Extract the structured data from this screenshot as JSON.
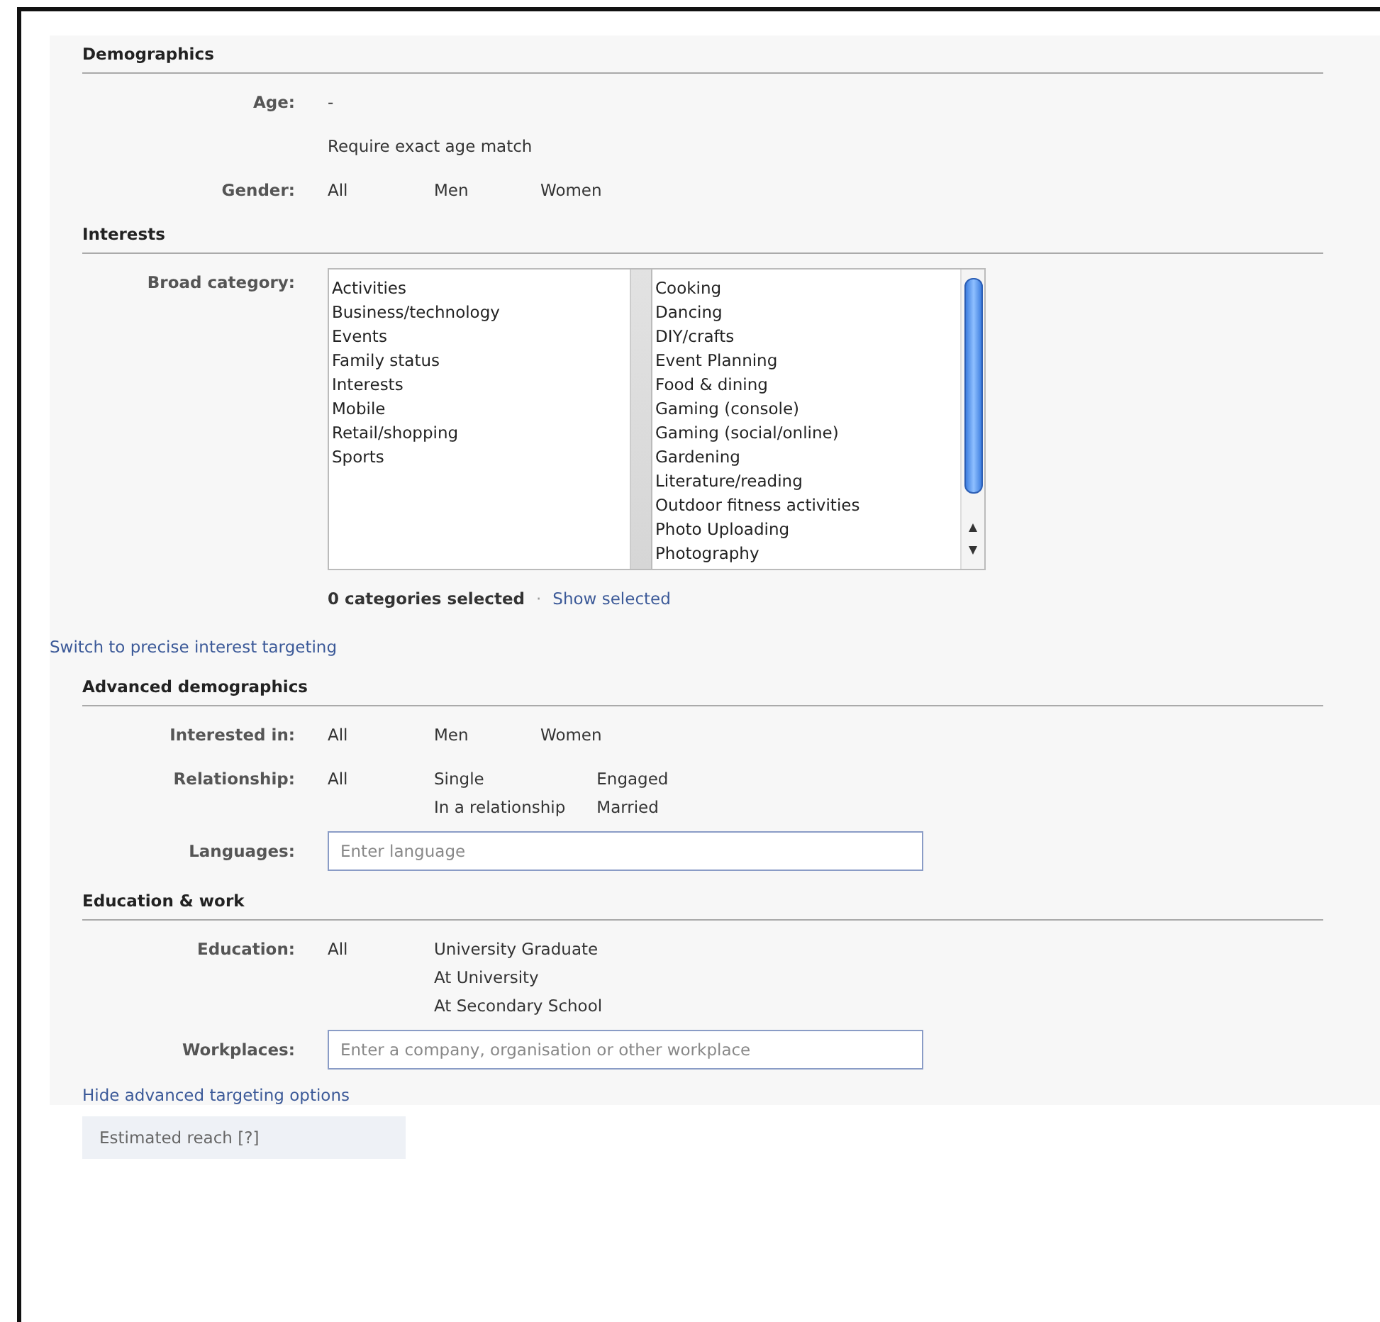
{
  "sections": [
    {
      "title": "Demographics",
      "rows": [
        {
          "kind": "text",
          "label": "Age:",
          "value": "-"
        },
        {
          "kind": "text",
          "value": "Require exact age match"
        },
        {
          "kind": "options",
          "label": "Gender:",
          "columns": [
            [
              "All"
            ],
            [
              "Men"
            ],
            [
              "Women"
            ]
          ]
        }
      ]
    },
    {
      "title": "Interests",
      "rows": [
        {
          "kind": "listbox",
          "label": "Broad category:",
          "categories": [
            "Activities",
            "Business/technology",
            "Events",
            "Family status",
            "Interests",
            "Mobile",
            "Retail/shopping",
            "Sports"
          ],
          "subcategories": [
            "Cooking",
            "Dancing",
            "DIY/crafts",
            "Event Planning",
            "Food & dining",
            "Gaming (console)",
            "Gaming (social/online)",
            "Gardening",
            "Literature/reading",
            "Outdoor fitness activities",
            "Photo Uploading",
            "Photography"
          ],
          "summary": "0 categories selected",
          "separator": "·",
          "summary_link": "Show selected"
        }
      ],
      "link": "Switch to precise interest targeting"
    },
    {
      "title": "Advanced demographics",
      "rows": [
        {
          "kind": "options",
          "label": "Interested in:",
          "columns": [
            [
              "All"
            ],
            [
              "Men"
            ],
            [
              "Women"
            ]
          ]
        },
        {
          "kind": "options",
          "label": "Relationship:",
          "columns": [
            [
              "All"
            ],
            [
              "Single",
              "In a relationship"
            ],
            [
              "Engaged",
              "Married"
            ]
          ]
        },
        {
          "kind": "field",
          "label": "Languages:",
          "placeholder": "Enter language"
        }
      ]
    },
    {
      "title": "Education & work",
      "rows": [
        {
          "kind": "options",
          "label": "Education:",
          "columns": [
            [
              "All"
            ],
            [
              "University Graduate",
              "At University",
              "At Secondary School"
            ]
          ]
        },
        {
          "kind": "field",
          "label": "Workplaces:",
          "placeholder": "Enter a company, organisation or other workplace"
        }
      ],
      "link": "Hide advanced targeting options"
    }
  ],
  "estimated_reach": "Estimated reach [?]"
}
